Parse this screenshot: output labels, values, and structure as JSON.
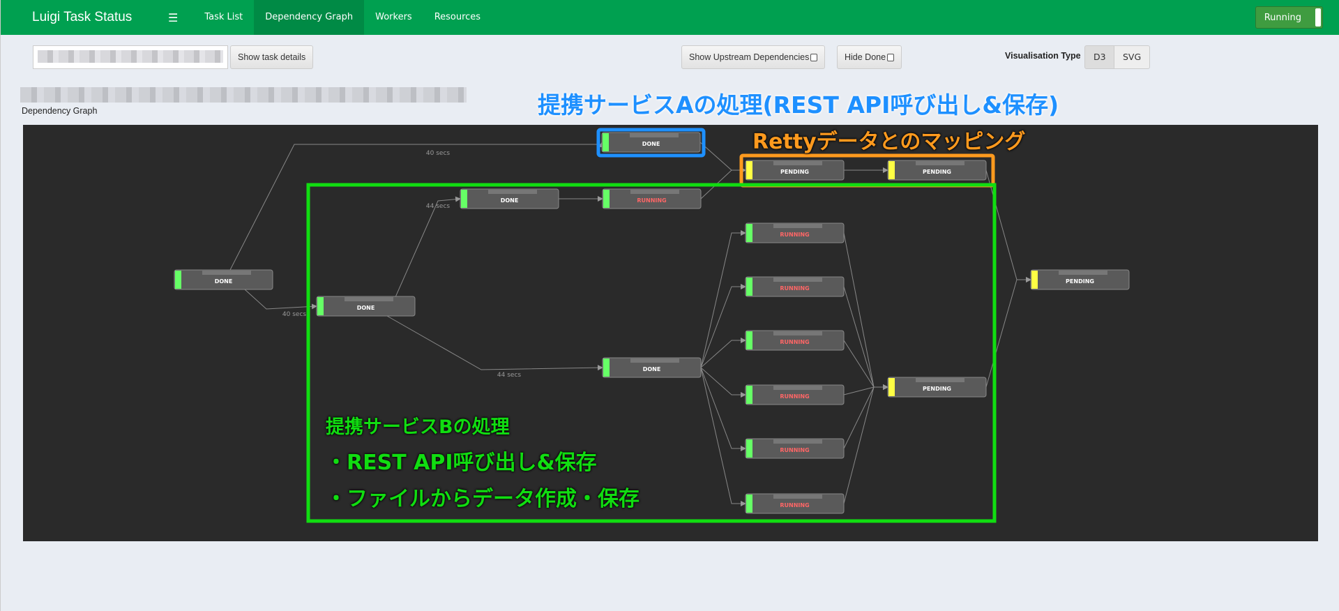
{
  "nav": {
    "brand": "Luigi Task Status",
    "menu_icon": "hamburger-icon",
    "items": [
      "Task List",
      "Dependency Graph",
      "Workers",
      "Resources"
    ],
    "active": "Dependency Graph",
    "status_button": "Running"
  },
  "toolbar": {
    "task_input_value": "",
    "show_details": "Show task details",
    "show_upstream": "Show Upstream Dependencies",
    "hide_done": "Hide Done",
    "vis_label": "Visualisation Type",
    "vis_options": [
      "D3",
      "SVG"
    ],
    "vis_selected": "D3"
  },
  "graph_title": "Dependency Graph",
  "colors": {
    "done": "#66ff66",
    "pending": "#ffff44",
    "running_text": "#ff6666",
    "brand": "#00a050",
    "annot_blue": "#1e90ff",
    "annot_orange": "#ff9a1e",
    "annot_green": "#11dd11"
  },
  "graph": {
    "nodes": [
      {
        "id": "n1",
        "status": "DONE"
      },
      {
        "id": "n2",
        "status": "PENDING"
      },
      {
        "id": "n3",
        "status": "PENDING"
      },
      {
        "id": "n4",
        "status": "DONE"
      },
      {
        "id": "n5",
        "status": "RUNNING"
      },
      {
        "id": "n6",
        "status": "DONE"
      },
      {
        "id": "n7",
        "status": "DONE"
      },
      {
        "id": "r1",
        "status": "RUNNING"
      },
      {
        "id": "r2",
        "status": "RUNNING"
      },
      {
        "id": "r3",
        "status": "RUNNING"
      },
      {
        "id": "r4",
        "status": "RUNNING"
      },
      {
        "id": "r5",
        "status": "RUNNING"
      },
      {
        "id": "r6",
        "status": "RUNNING"
      },
      {
        "id": "n9",
        "status": "DONE"
      },
      {
        "id": "n10",
        "status": "PENDING"
      },
      {
        "id": "n11",
        "status": "PENDING"
      }
    ],
    "edges": [
      {
        "from": "n6",
        "to": "n1",
        "label": "40 secs"
      },
      {
        "from": "n6",
        "to": "n7",
        "label": "40 secs"
      },
      {
        "from": "n7",
        "to": "n4",
        "label": "44 secs"
      },
      {
        "from": "n7",
        "to": "n9",
        "label": "44 secs"
      },
      {
        "from": "n4",
        "to": "n5"
      },
      {
        "from": "n5",
        "to": "n2"
      },
      {
        "from": "n1",
        "to": "n2"
      },
      {
        "from": "n2",
        "to": "n3"
      },
      {
        "from": "n3",
        "to": "n11"
      },
      {
        "from": "n9",
        "to": "r1"
      },
      {
        "from": "n9",
        "to": "r2"
      },
      {
        "from": "n9",
        "to": "r3"
      },
      {
        "from": "n9",
        "to": "r4"
      },
      {
        "from": "n9",
        "to": "r5"
      },
      {
        "from": "n9",
        "to": "r6"
      },
      {
        "from": "r1",
        "to": "n10"
      },
      {
        "from": "r2",
        "to": "n10"
      },
      {
        "from": "r3",
        "to": "n10"
      },
      {
        "from": "r4",
        "to": "n10"
      },
      {
        "from": "r5",
        "to": "n10"
      },
      {
        "from": "r6",
        "to": "n10"
      },
      {
        "from": "n10",
        "to": "n11"
      }
    ]
  },
  "annotations": {
    "service_a": "提携サービスAの処理(REST API呼び出し&保存)",
    "retty_mapping": "Rettyデータとのマッピング",
    "service_b": "提携サービスBの処理",
    "service_b_item1": "・REST API呼び出し&保存",
    "service_b_item2": "・ファイルからデータ作成・保存"
  }
}
